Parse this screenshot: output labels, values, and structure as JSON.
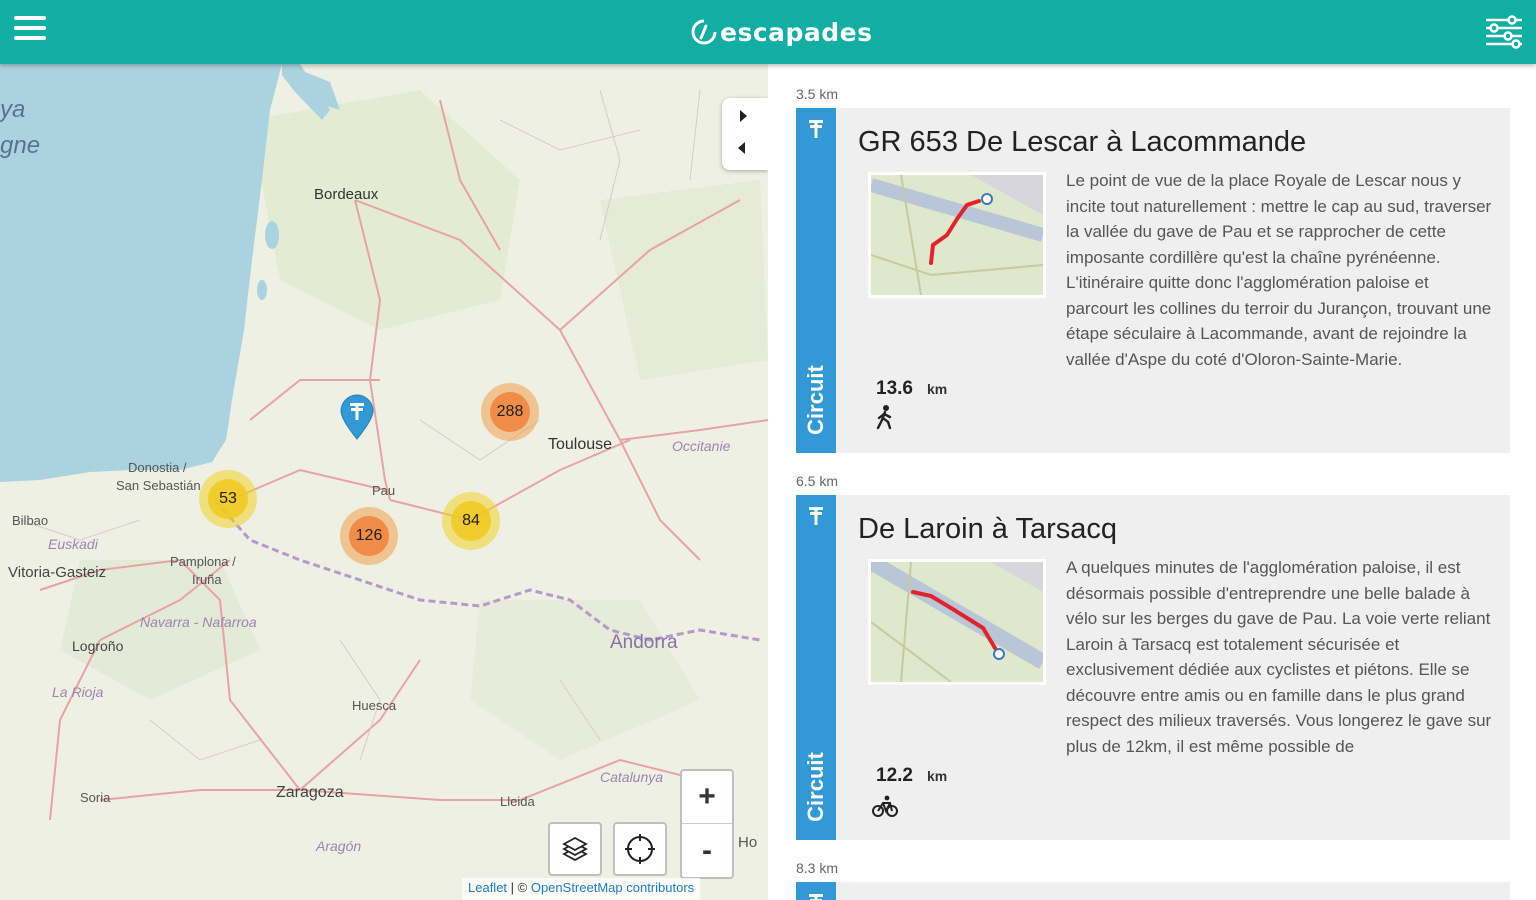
{
  "header": {
    "brand": "escapades",
    "colors": {
      "header_bg": "#12ada3",
      "band": "#3399d6"
    },
    "menu_icon": "hamburger-menu-icon",
    "filter_icon": "sliders-filter-icon"
  },
  "map": {
    "toggle_icons": [
      "expand-right-icon",
      "collapse-left-icon"
    ],
    "labels": {
      "sea_1": "ya",
      "sea_2": "gne",
      "bordeaux": "Bordeaux",
      "toulouse": "Toulouse",
      "occitanie": "Occitanie",
      "donostia_1": "Donostia /",
      "donostia_2": "San Sebastián",
      "bilbao": "Bilbao",
      "euskadi": "Euskadi",
      "vitoria": "Vitoria-Gasteiz",
      "pau": "Pau",
      "pamplona_1": "Pamplona /",
      "pamplona_2": "Iruña",
      "navarra": "Navarra - Nafarroa",
      "logrono": "Logroño",
      "la_rioja": "La Rioja",
      "andorra": "Andorra",
      "huesca": "Huesca",
      "catalunya": "Catalunya",
      "soria": "Soria",
      "zaragoza": "Zaragoza",
      "lleida": "Lleida",
      "aragon": "Aragón",
      "partial": "Ho"
    },
    "clusters": {
      "c288": "288",
      "c53": "53",
      "c126": "126",
      "c84": "84"
    },
    "marker_icon": "hiking-map-marker-icon",
    "zoom_in": "+",
    "zoom_out": "-",
    "layers_icon": "layers-icon",
    "locate_icon": "locate-crosshair-icon",
    "attribution": {
      "leaflet": "Leaflet",
      "sep": " | © ",
      "osm": "OpenStreetMap contributors"
    }
  },
  "list": {
    "items": [
      {
        "distance": "3.5 km",
        "type": "Circuit",
        "title": "GR 653 De Lescar à Lacommande",
        "description": "Le point de vue de la place Royale de Lescar nous y incite tout naturellement : mettre le cap au sud, traverser la vallée du gave de Pau et se rapprocher de cette imposante cordillère qu'est la chaîne pyrénéenne. L'itinéraire quitte donc l'agglomération paloise et parcourt les collines du terroir du Jurançon, trouvant une étape séculaire à Lacommande, avant de rejoindre la vallée d'Aspe du coté d'Oloron-Sainte-Marie.",
        "length": "13.6",
        "unit": "km",
        "mode_icon": "walking-icon",
        "band_icon": "hiking-sign-icon"
      },
      {
        "distance": "6.5 km",
        "type": "Circuit",
        "title": "De Laroin à Tarsacq",
        "description": "A quelques minutes de l'agglomération paloise, il est désormais possible d'entreprendre une belle balade à vélo sur les berges du gave de Pau. La voie verte reliant Laroin à Tarsacq est totalement sécurisée et exclusivement dédiée aux cyclistes et piétons. Elle se découvre entre amis ou en famille dans le plus grand respect des milieux traversés. Vous longerez le gave sur plus de 12km, il est même possible de",
        "length": "12.2",
        "unit": "km",
        "mode_icon": "bicycle-icon",
        "band_icon": "hiking-sign-icon"
      },
      {
        "distance": "8.3 km"
      }
    ]
  }
}
